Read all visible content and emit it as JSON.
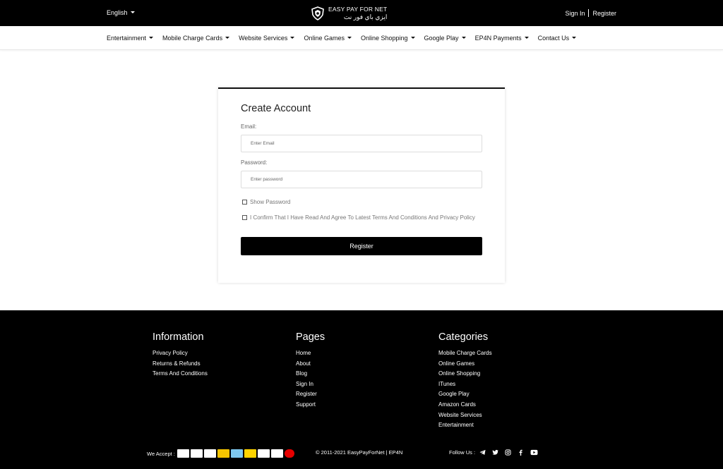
{
  "topbar": {
    "language": "English",
    "logo_en": "EASY PAY FOR NET",
    "logo_ar": "ايزي باي فور نت",
    "sign_in": "Sign In",
    "register": "Register"
  },
  "nav": {
    "items": [
      "Entertainment",
      "Mobile Charge Cards",
      "Website Services",
      "Online Games",
      "Online Shopping",
      "Google Play",
      "EP4N Payments",
      "Contact Us"
    ]
  },
  "form": {
    "title": "Create Account",
    "email_label": "Email:",
    "email_placeholder": "Enter Email",
    "password_label": "Password:",
    "password_placeholder": "Enter password",
    "show_password": "Show Password",
    "terms": "I Confirm That I Have Read And Agree To Latest Terms And Conditions And Privacy Policy",
    "submit": "Register"
  },
  "footer": {
    "information": {
      "title": "Information",
      "links": [
        "Privacy Policy",
        "Returns & Refunds",
        "Terms And Conditions"
      ]
    },
    "pages": {
      "title": "Pages",
      "links": [
        "Home",
        "About",
        "Blog",
        "Sign In",
        "Register",
        "Support"
      ]
    },
    "categories": {
      "title": "Categories",
      "links": [
        "Mobile Charge Cards",
        "Online Games",
        "Online Shopping",
        "ITunes",
        "Google Play",
        "Amazon Cards",
        "Website Services",
        "Entertainment"
      ]
    },
    "we_accept": "We Accept :",
    "copyright": "© 2011-2021 EasyPayForNet | EP4N",
    "follow_us": "Follow Us :"
  },
  "colors": {
    "brand_dark": "#000000",
    "text": "#222222"
  },
  "icons": {
    "language_caret": "chevron-down-icon",
    "logo": "shield-logo-icon",
    "social": [
      "telegram-icon",
      "twitter-icon",
      "instagram-icon",
      "facebook-icon",
      "youtube-icon"
    ]
  }
}
